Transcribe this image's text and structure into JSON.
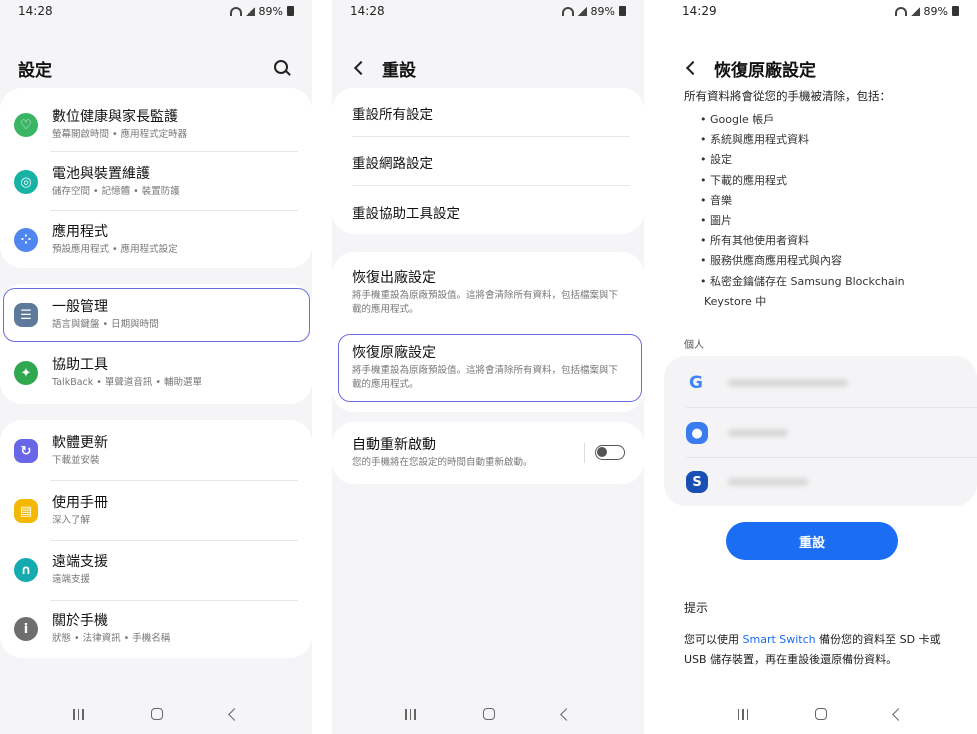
{
  "status": [
    {
      "time": "14:28",
      "battery": "89%"
    },
    {
      "time": "14:28",
      "battery": "89%"
    },
    {
      "time": "14:29",
      "battery": "89%"
    }
  ],
  "panel1": {
    "title": "設定",
    "items": [
      {
        "label": "數位健康與家長監護",
        "sub": "螢幕開啟時間 • 應用程式定時器",
        "icon": "digital-wellbeing-icon",
        "color": "#3ab563"
      },
      {
        "label": "電池與裝置維護",
        "sub": "儲存空間 • 記憶體 • 裝置防護",
        "icon": "device-care-icon",
        "color": "#18b2a4"
      },
      {
        "label": "應用程式",
        "sub": "預設應用程式 • 應用程式設定",
        "icon": "apps-icon",
        "color": "#4f86f0"
      },
      {
        "label": "一般管理",
        "sub": "語言與鍵盤 • 日期與時間",
        "icon": "general-management-icon",
        "color": "#5d7a9a"
      },
      {
        "label": "協助工具",
        "sub": "TalkBack • 單聲道音訊 • 輔助選單",
        "icon": "accessibility-icon",
        "color": "#2fa84f"
      },
      {
        "label": "軟體更新",
        "sub": "下載並安裝",
        "icon": "software-update-icon",
        "color": "#6a66e8"
      },
      {
        "label": "使用手冊",
        "sub": "深入了解",
        "icon": "user-manual-icon",
        "color": "#f5b800"
      },
      {
        "label": "遠端支援",
        "sub": "遠端支援",
        "icon": "remote-support-icon",
        "color": "#15a9b0"
      },
      {
        "label": "關於手機",
        "sub": "狀態 • 法律資訊 • 手機名稱",
        "icon": "about-phone-icon",
        "color": "#6e6e6e"
      }
    ]
  },
  "panel2": {
    "title": "重設",
    "top_items": [
      "重設所有設定",
      "重設網路設定",
      "重設協助工具設定"
    ],
    "restore1": {
      "label": "恢復出廠設定",
      "sub": "將手機重設為原廠預設值。這將會清除所有資料，包括檔案與下載的應用程式。"
    },
    "restore2": {
      "label": "恢復原廠設定",
      "sub": "將手機重設為原廠預設值。這將會清除所有資料，包括檔案與下載的應用程式。"
    },
    "auto": {
      "label": "自動重新啟動",
      "sub": "您的手機將在您設定的時間自動重新啟動。"
    }
  },
  "panel3": {
    "title": "恢復原廠設定",
    "intro": "所有資料將會從您的手機被清除，包括：",
    "bullets": [
      "• Google 帳戶",
      "• 系統與應用程式資料",
      "• 設定",
      "• 下載的應用程式",
      "• 音樂",
      "• 圖片",
      "• 所有其他使用者資料",
      "• 服務供應商應用程式與內容",
      "• 私密金鑰儲存在 Samsung Blockchain",
      "Keystore 中"
    ],
    "section": "個人",
    "reset_label": "重設",
    "tips_title": "提示",
    "tips_pre": "您可以使用 ",
    "tips_link": "Smart Switch",
    "tips_post": " 備份您的資料至 SD 卡或",
    "tips_line2": "USB 儲存裝置，再在重設後還原備份資料。"
  }
}
